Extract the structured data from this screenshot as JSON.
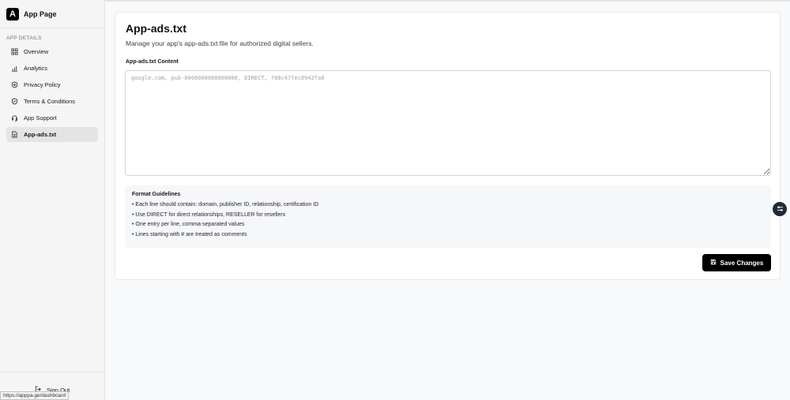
{
  "app": {
    "logo_letter": "A",
    "name": "App Page"
  },
  "sidebar": {
    "section_label": "APP DETAILS",
    "items": [
      {
        "label": "Overview",
        "icon": "grid-icon",
        "active": false
      },
      {
        "label": "Analytics",
        "icon": "bar-chart-icon",
        "active": false
      },
      {
        "label": "Privacy Policy",
        "icon": "shield-icon",
        "active": false
      },
      {
        "label": "Terms & Conditions",
        "icon": "shield-check-icon",
        "active": false
      },
      {
        "label": "App Support",
        "icon": "headset-icon",
        "active": false
      },
      {
        "label": "App-ads.txt",
        "icon": "file-text-icon",
        "active": true
      }
    ],
    "sign_out_label": "Sign Out"
  },
  "status_bar": {
    "url": "https://apppa.ge/dashboard"
  },
  "main": {
    "title": "App-ads.txt",
    "subtitle": "Manage your app's app-ads.txt file for authorized digital sellers.",
    "field_label": "App-ads.txt Content",
    "content_value": "",
    "content_placeholder": "google.com, pub-0000000000000000, DIRECT, f08c47fec0942fa0",
    "guidelines": {
      "title": "Format Guidelines",
      "items": [
        "• Each line should contain: domain, publisher ID, relationship, certification ID",
        "• Use DIRECT for direct relationships, RESELLER for resellers",
        "• One entry per line, comma-separated values",
        "• Lines starting with # are treated as comments"
      ]
    },
    "save_label": "Save Changes"
  },
  "colors": {
    "accent": "#000000",
    "sidebar_bg": "#f5f5f5",
    "active_item_bg": "#e4e4e7",
    "page_bg": "#f8f9fa"
  }
}
